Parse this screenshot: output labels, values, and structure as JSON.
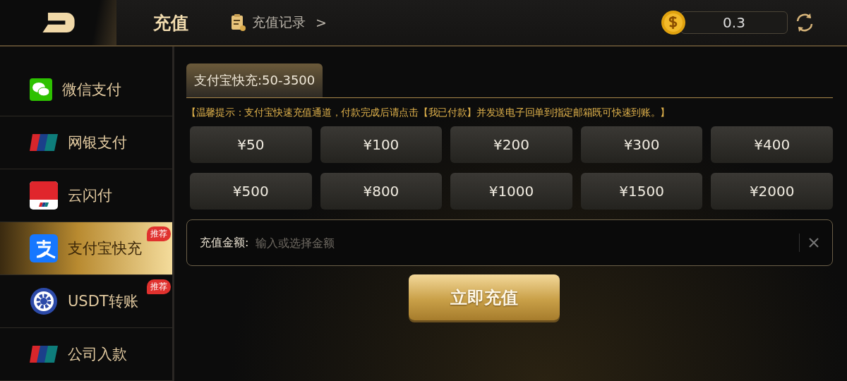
{
  "header": {
    "title": "充值",
    "record_link": "充值记录",
    "record_arrow": ">",
    "balance": "0.3"
  },
  "methods": [
    {
      "label": "微信支付",
      "kind": "wechat",
      "selected": false
    },
    {
      "label": "网银支付",
      "kind": "unionpay",
      "selected": false
    },
    {
      "label": "云闪付",
      "kind": "cloudpay",
      "selected": false
    },
    {
      "label": "支付宝快充",
      "kind": "alipay",
      "selected": true,
      "badge": "推荐"
    },
    {
      "label": "USDT转账",
      "kind": "usdt",
      "selected": false,
      "badge": "推荐"
    },
    {
      "label": "公司入款",
      "kind": "unionpay",
      "selected": false
    }
  ],
  "tabs": [
    {
      "label": "支付宝快充:50-3500",
      "selected": true
    }
  ],
  "notice": "【温馨提示：支付宝快速充值通道，付款完成后请点击【我已付款】并发送电子回单到指定邮箱既可快速到账。】",
  "amounts": [
    "¥50",
    "¥100",
    "¥200",
    "¥300",
    "¥400",
    "¥500",
    "¥800",
    "¥1000",
    "¥1500",
    "¥2000"
  ],
  "amount_field": {
    "label": "充值金额:",
    "placeholder": "输入或选择金额"
  },
  "submit": "立即充值"
}
